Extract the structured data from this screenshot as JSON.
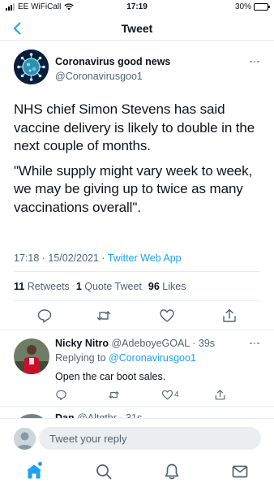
{
  "status_bar": {
    "carrier": "EE WiFiCall",
    "time": "17:19",
    "battery": "30%",
    "battery_level": 0.3
  },
  "header": {
    "title": "Tweet",
    "back_icon": "chevron-left-icon"
  },
  "tweet": {
    "author_name": "Coronavirus good news",
    "author_handle": "@Coronavirusgoo1",
    "paragraphs": [
      "NHS chief Simon Stevens has said vaccine delivery is likely to double in the next couple of months.",
      "\"While supply might vary week to week, we may be giving up to twice as many vaccinations overall\"."
    ],
    "timestamp": "17:18 · 15/02/2021 · ",
    "source_app": "Twitter Web App",
    "stats": {
      "retweets_count": "11",
      "retweets_label": "Retweets",
      "quotes_count": "1",
      "quotes_label": "Quote Tweet",
      "likes_count": "96",
      "likes_label": "Likes"
    },
    "action_icons": [
      "reply-icon",
      "retweet-icon",
      "like-icon",
      "share-icon"
    ]
  },
  "replies": [
    {
      "name": "Nicky Nitro",
      "handle": "@AdeboyeGOAL · 39s",
      "replying_prefix": "Replying to ",
      "replying_to": "@Coronavirusgoo1",
      "text": "Open the car boot sales.",
      "like_count": "4"
    },
    {
      "name": "Dan",
      "handle": "@Altqthr · 31s"
    }
  ],
  "composer": {
    "placeholder": "Tweet your reply"
  },
  "tabbar": {
    "items": [
      "home-icon",
      "search-icon",
      "notifications-icon",
      "messages-icon"
    ],
    "accent": "#1da1f2"
  },
  "colors": {
    "accent": "#1da1f2",
    "text": "#0f1419",
    "secondary": "#536471"
  }
}
